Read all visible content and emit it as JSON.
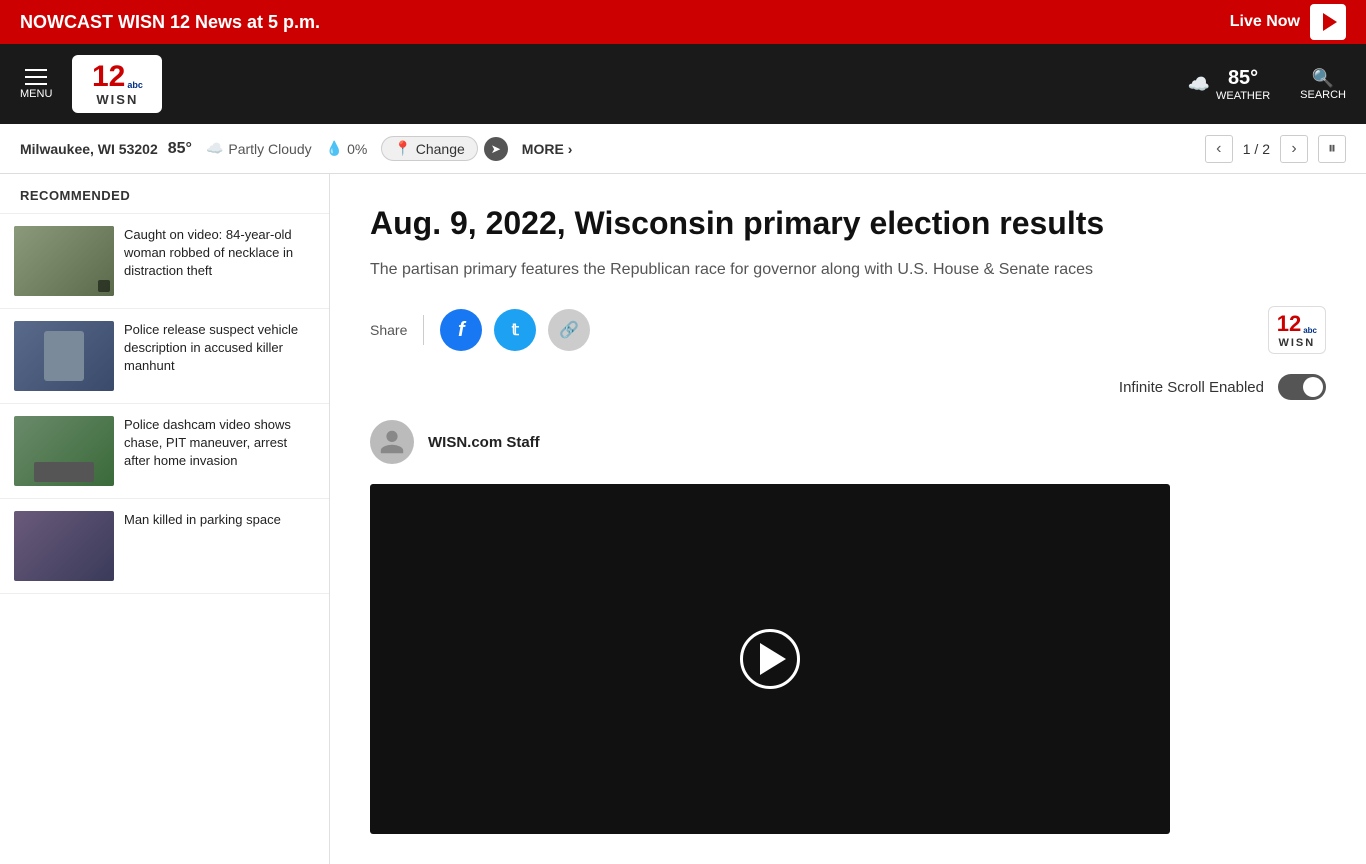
{
  "breaking_bar": {
    "nowcast_text": "NOWCAST WISN 12 News at 5 p.m.",
    "live_label": "Live Now"
  },
  "header": {
    "menu_label": "MENU",
    "logo_text": "12",
    "logo_abc": "abc",
    "logo_wisn": "WISN",
    "weather_temp": "85°",
    "weather_label": "WEATHER",
    "search_label": "SEARCH"
  },
  "weather_bar": {
    "location": "Milwaukee, WI 53202",
    "temp": "85°",
    "condition": "Partly Cloudy",
    "precip_icon": "💧",
    "precip": "0%",
    "change_label": "Change",
    "more_label": "MORE",
    "page_current": "1",
    "page_total": "2"
  },
  "sidebar": {
    "recommended_label": "RECOMMENDED",
    "items": [
      {
        "text": "Caught on video: 84-year-old woman robbed of necklace in distraction theft",
        "thumb_class": "sidebar-thumb-1"
      },
      {
        "text": "Police release suspect vehicle description in accused killer manhunt",
        "thumb_class": "sidebar-thumb-2"
      },
      {
        "text": "Police dashcam video shows chase, PIT maneuver, arrest after home invasion",
        "thumb_class": "sidebar-thumb-3"
      },
      {
        "text": "Man killed in parking space",
        "thumb_class": "sidebar-thumb-4"
      }
    ]
  },
  "article": {
    "title": "Aug. 9, 2022, Wisconsin primary election results",
    "subtitle": "The partisan primary features the Republican race for governor along with U.S. House & Senate races",
    "share_label": "Share",
    "author": "WISN.com Staff",
    "infinite_scroll_label": "Infinite Scroll Enabled"
  },
  "share_buttons": {
    "facebook_icon": "f",
    "twitter_icon": "t",
    "link_icon": "🔗"
  }
}
